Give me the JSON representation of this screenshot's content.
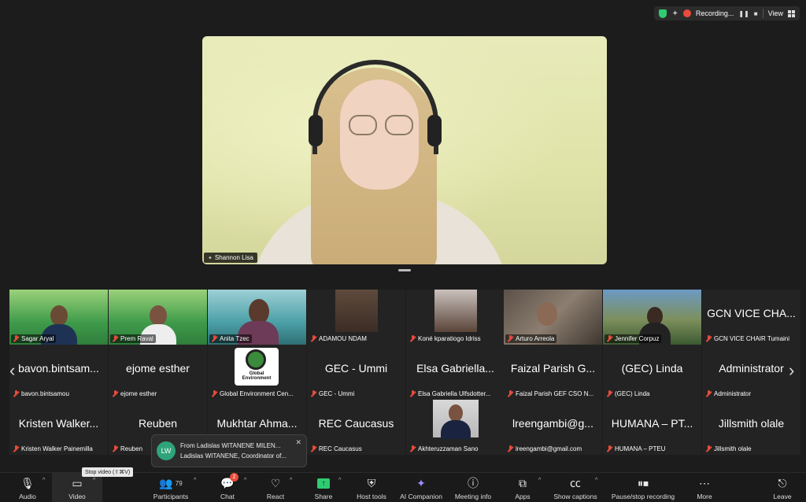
{
  "topbar": {
    "recording_label": "Recording...",
    "pause_icon": "pause-icon",
    "stop_icon": "stop-icon",
    "view_label": "View"
  },
  "speaker": {
    "name": "Shannon Lisa"
  },
  "gallery": {
    "row1": [
      {
        "name": "Sagar Aryal",
        "style": "vid-green"
      },
      {
        "name": "Prem Raval",
        "style": "vid-green"
      },
      {
        "name": "Anita Tzec",
        "style": "vid-ocean"
      },
      {
        "name": "ADAMOU NDAM",
        "style": "vid-room"
      },
      {
        "name": "Koné kparatiogo Idriss",
        "style": "vid-room"
      },
      {
        "name": "Arturo Arreola",
        "style": "vid-room"
      },
      {
        "name": "Jennifer Corpuz",
        "style": "vid-mtn"
      },
      {
        "name": "GCN VICE CHAIR Tumaini",
        "big": "GCN VICE CHA...",
        "style": "vid-dark"
      }
    ],
    "row2": [
      {
        "name": "bavon.bintsamou",
        "big": "bavon.bintsam..."
      },
      {
        "name": "ejome esther",
        "big": "ejome esther"
      },
      {
        "name": "Global Environment Cen...",
        "big": "",
        "logo": "Global Environment"
      },
      {
        "name": "GEC - Ummi",
        "big": "GEC - Ummi"
      },
      {
        "name": "Elsa Gabriella Ulfsdotter...",
        "big": "Elsa Gabriella..."
      },
      {
        "name": "Faizal Parish GEF CSO N...",
        "big": "Faizal Parish G..."
      },
      {
        "name": "(GEC) Linda",
        "big": "(GEC) Linda"
      },
      {
        "name": "Administrator",
        "big": "Administrator"
      }
    ],
    "row3": [
      {
        "name": "Kristen Walker Painemilla",
        "big": "Kristen Walker..."
      },
      {
        "name": "Reuben",
        "big": "Reuben"
      },
      {
        "name": "Mukhtar Ahma...",
        "big": "Mukhtar Ahma..."
      },
      {
        "name": "REC Caucasus",
        "big": "REC Caucasus"
      },
      {
        "name": "Akhteruzzaman Sano",
        "big": ""
      },
      {
        "name": "lreengambi@gmail.com",
        "big": "lreengambi@g..."
      },
      {
        "name": "HUMANA – PTEU",
        "big": "HUMANA – PT..."
      },
      {
        "name": "Jillsmith olale",
        "big": "Jillsmith olale"
      }
    ]
  },
  "chat_popup": {
    "avatar": "LW",
    "line1": "From Ladislas WITANENE MILEN...",
    "line2": "Ladislas WITANENE, Coordinator of..."
  },
  "tooltip": "Stop video (⇧⌘V)",
  "toolbar": {
    "audio": "Audio",
    "video": "Video",
    "participants": "Participants",
    "participants_count": "79",
    "chat": "Chat",
    "chat_badge": "2",
    "react": "React",
    "share": "Share",
    "host_tools": "Host tools",
    "ai_companion": "AI Companion",
    "meeting_info": "Meeting info",
    "apps": "Apps",
    "show_captions": "Show captions",
    "pause_stop": "Pause/stop recording",
    "more": "More",
    "leave": "Leave"
  },
  "colors": {
    "accent_green": "#2ecc71",
    "mute_red": "#e74c3c",
    "bg": "#1c1c1c"
  }
}
